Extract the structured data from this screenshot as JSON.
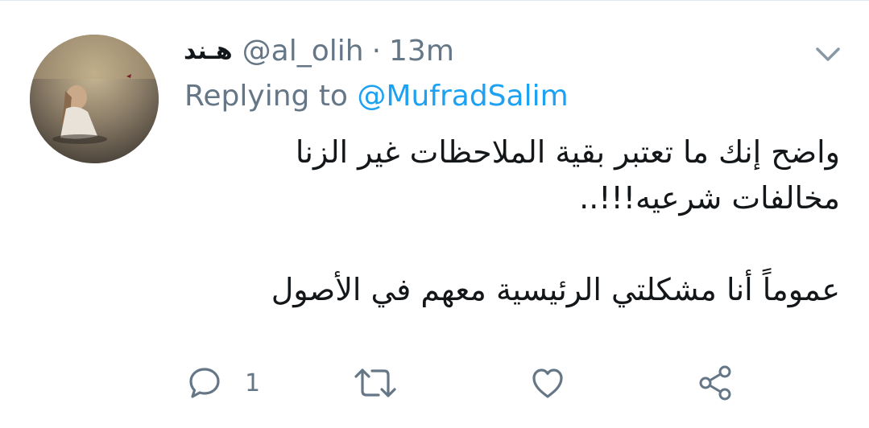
{
  "tweet": {
    "display_name": "هـند",
    "handle": "@al_olih",
    "separator": "·",
    "time": "13m",
    "replying_prefix": "Replying to",
    "replying_to": "@MufradSalim",
    "body_lines": [
      "واضح إنك ما تعتبر بقية الملاحظات غير الزنا",
      "مخالفات شرعيه!!!..",
      "عموماً أنا مشكلتي الرئيسية معهم في الأصول"
    ]
  },
  "actions": {
    "reply_count": "1",
    "icons": [
      "reply-icon",
      "retweet-icon",
      "like-icon",
      "share-icon"
    ]
  },
  "colors": {
    "secondary_text": "#657786",
    "link": "#1da1f2",
    "primary_text": "#14171a"
  }
}
